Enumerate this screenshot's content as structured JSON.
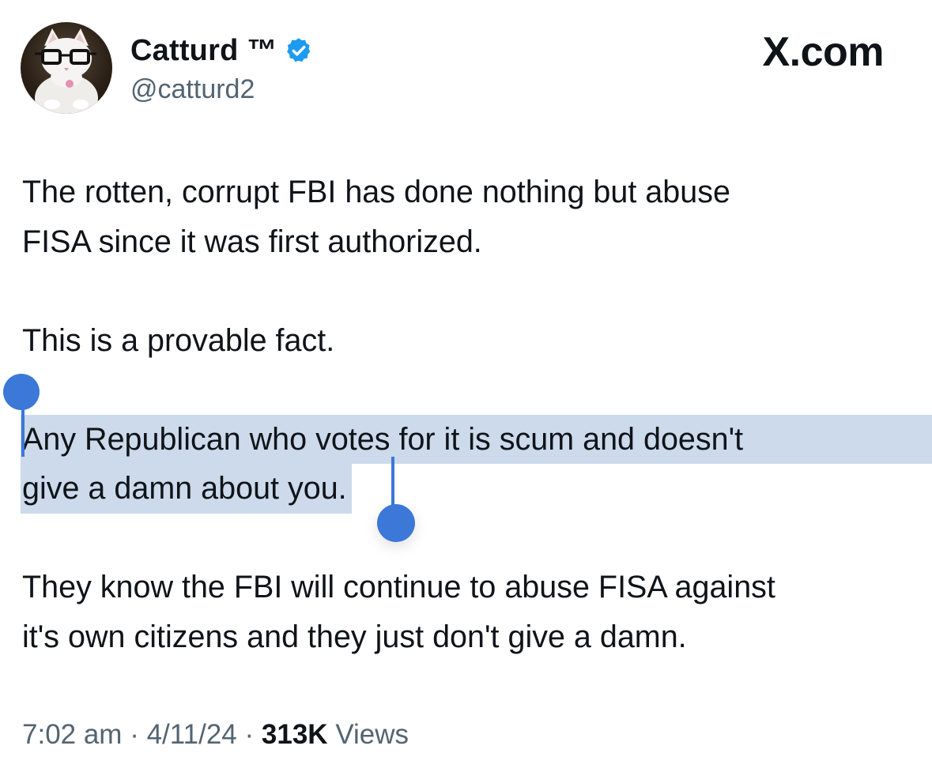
{
  "author": {
    "display_name": "Catturd ™",
    "handle": "@catturd2",
    "verified": true,
    "avatar_icon": "cat-with-glasses-avatar"
  },
  "brand": "X.com",
  "tweet": {
    "paragraph1_line1": "The rotten, corrupt FBI has done nothing but abuse",
    "paragraph1_line2": "FISA since it was first authorized.",
    "paragraph2": "This is a provable fact.",
    "paragraph3_line1": "Any Republican who votes for it is scum and doesn't",
    "paragraph3_line2": "give a damn about you.",
    "paragraph4_line1": "They know the FBI will continue to abuse FISA against",
    "paragraph4_line2": "it's own citizens and they just don't give a damn."
  },
  "meta": {
    "time": "7:02 am",
    "separator": "·",
    "date": "4/11/24",
    "views_count": "313K",
    "views_label": "Views"
  },
  "colors": {
    "text": "#0f1419",
    "secondary": "#536471",
    "selection": "#ccdaeb",
    "selection_handle": "#3b78d8",
    "verified_badge": "#1d9bf0"
  }
}
